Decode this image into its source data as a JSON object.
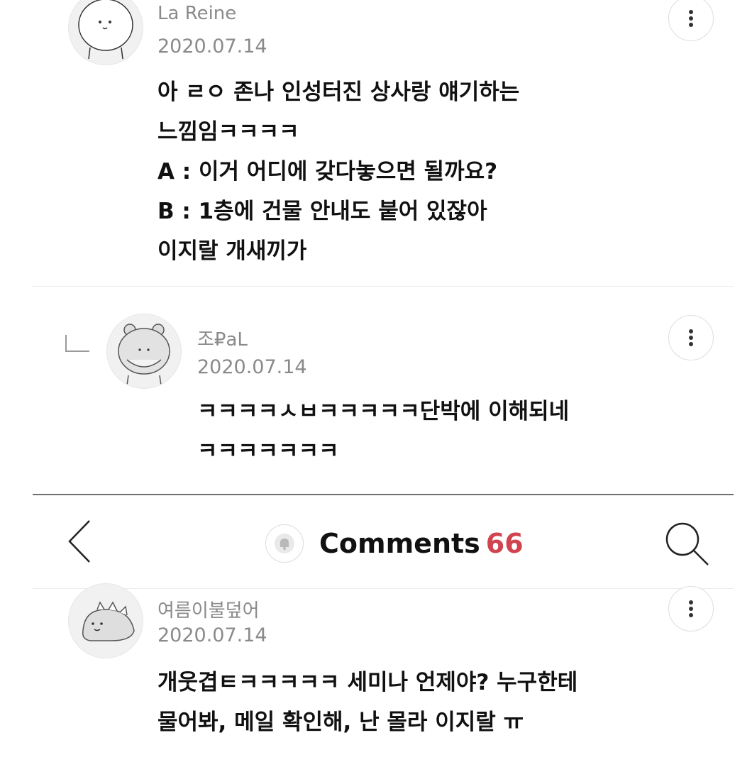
{
  "comments": [
    {
      "author": "La Reine",
      "date": "2020.07.14",
      "text": "아 ㄹㅇ 존나 인성터진 상사랑 얘기하는\n느낌임ㅋㅋㅋㅋ\nA : 이거 어디에 갖다놓으면 될까요?\nB : 1층에 건물 안내도 붙어 있잖아\n이지랄 개새끼가",
      "avatar_icon": "bear-avatar-icon",
      "more_icon": "more-vertical-icon"
    },
    {
      "author": "조₽aL",
      "date": "2020.07.14",
      "text": "ㅋㅋㅋㅋㅅㅂㅋㅋㅋㅋㅋ단박에 이해되네\nㅋㅋㅋㅋㅋㅋㅋ",
      "avatar_icon": "bearded-bear-avatar-icon",
      "reply_icon": "reply-corner-icon",
      "more_icon": "more-vertical-icon"
    },
    {
      "author": "여름이불덮어",
      "date": "2020.07.14",
      "text": "개웃겹ㅌㅋㅋㅋㅋㅋ 세미나 언제야? 누구한테\n물어봐, 메일 확인해, 난 몰라 이지랄 ㅠ",
      "avatar_icon": "dinosaur-avatar-icon",
      "more_icon": "more-vertical-icon"
    }
  ],
  "header": {
    "title": "Comments",
    "count": "66",
    "count_color": "#d0434f",
    "back_icon": "back-chevron-icon",
    "bell_icon": "bell-icon",
    "search_icon": "search-icon"
  }
}
